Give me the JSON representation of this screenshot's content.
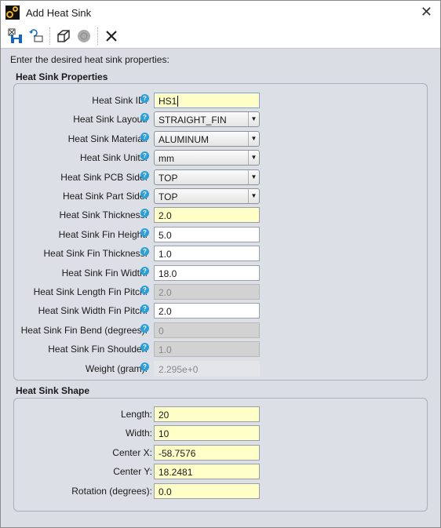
{
  "window": {
    "title": "Add Heat Sink",
    "close": "✕"
  },
  "toolbar": {
    "items": [
      {
        "name": "save-close-icon"
      },
      {
        "name": "undo-icon"
      },
      {
        "name": "3d-view-icon"
      },
      {
        "name": "render-icon"
      },
      {
        "name": "cancel-icon"
      }
    ]
  },
  "intro": "Enter the desired heat sink properties:",
  "properties": {
    "title": "Heat Sink Properties",
    "rows": [
      {
        "label": "Heat Sink ID:",
        "value": "HS1",
        "type": "yellow focus"
      },
      {
        "label": "Heat Sink Layout:",
        "value": "STRAIGHT_FIN",
        "type": "combo"
      },
      {
        "label": "Heat Sink Material:",
        "value": "ALUMINUM",
        "type": "combo"
      },
      {
        "label": "Heat Sink Units:",
        "value": "mm",
        "type": "combo"
      },
      {
        "label": "Heat Sink PCB Side:",
        "value": "TOP",
        "type": "combo"
      },
      {
        "label": "Heat Sink Part Side:",
        "value": "TOP",
        "type": "combo"
      },
      {
        "label": "Heat Sink Thickness:",
        "value": "2.0",
        "type": "yellow"
      },
      {
        "label": "Heat Sink Fin Height:",
        "value": "5.0",
        "type": "white"
      },
      {
        "label": "Heat Sink Fin Thickness:",
        "value": "1.0",
        "type": "white"
      },
      {
        "label": "Heat Sink Fin Width:",
        "value": "18.0",
        "type": "white"
      },
      {
        "label": "Heat Sink Length Fin Pitch:",
        "value": "2.0",
        "type": "disabled"
      },
      {
        "label": "Heat Sink Width Fin Pitch:",
        "value": "2.0",
        "type": "white"
      },
      {
        "label": "Heat Sink Fin Bend (degrees):",
        "value": "0",
        "type": "disabled"
      },
      {
        "label": "Heat Sink Fin Shoulder:",
        "value": "1.0",
        "type": "disabled"
      },
      {
        "label": "Weight (gram):",
        "value": "2.295e+0",
        "type": "readonly"
      }
    ]
  },
  "shape": {
    "title": "Heat Sink Shape",
    "rows": [
      {
        "label": "Length:",
        "value": "20",
        "type": "yellow"
      },
      {
        "label": "Width:",
        "value": "10",
        "type": "yellow"
      },
      {
        "label": "Center X:",
        "value": "-58.7576",
        "type": "yellow"
      },
      {
        "label": "Center Y:",
        "value": "18.2481",
        "type": "yellow"
      },
      {
        "label": "Rotation (degrees):",
        "value": "0.0",
        "type": "yellow"
      }
    ]
  },
  "help_glyph": "?",
  "dropdown_glyph": "▼"
}
